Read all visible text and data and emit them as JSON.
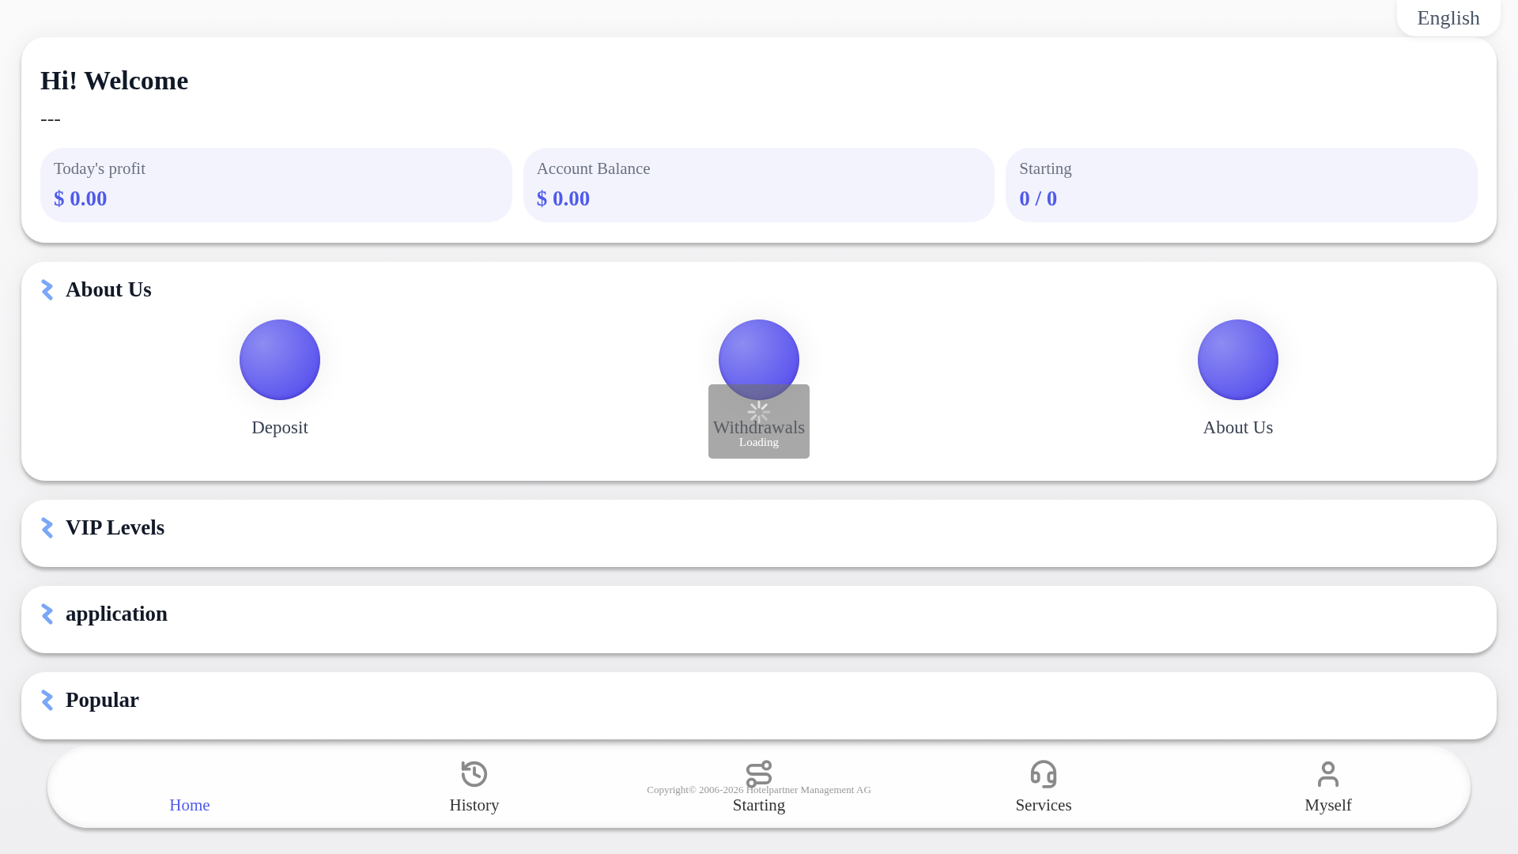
{
  "language": "English",
  "welcome": {
    "title": "Hi! Welcome",
    "subtitle": "---"
  },
  "stats": [
    {
      "label": "Today's profit",
      "value": "$ 0.00"
    },
    {
      "label": "Account Balance",
      "value": "$ 0.00"
    },
    {
      "label": "Starting",
      "value": "0 / 0"
    }
  ],
  "sections": [
    {
      "title": "About Us",
      "items": [
        {
          "label": "Deposit",
          "loading": false
        },
        {
          "label": "Withdrawals",
          "loading": true
        },
        {
          "label": "About Us",
          "loading": false
        }
      ]
    },
    {
      "title": "VIP Levels"
    },
    {
      "title": "application"
    },
    {
      "title": "Popular"
    }
  ],
  "loading_text": "Loading",
  "copyright": "Copyright© 2006-2026 Hotelpartner Management AG",
  "nav": [
    {
      "label": "Home",
      "kind": "home",
      "selected": true
    },
    {
      "label": "History",
      "kind": "history",
      "selected": false
    },
    {
      "label": "Starting",
      "kind": "route",
      "selected": false
    },
    {
      "label": "Services",
      "kind": "headset",
      "selected": false
    },
    {
      "label": "Myself",
      "kind": "user",
      "selected": false
    }
  ]
}
